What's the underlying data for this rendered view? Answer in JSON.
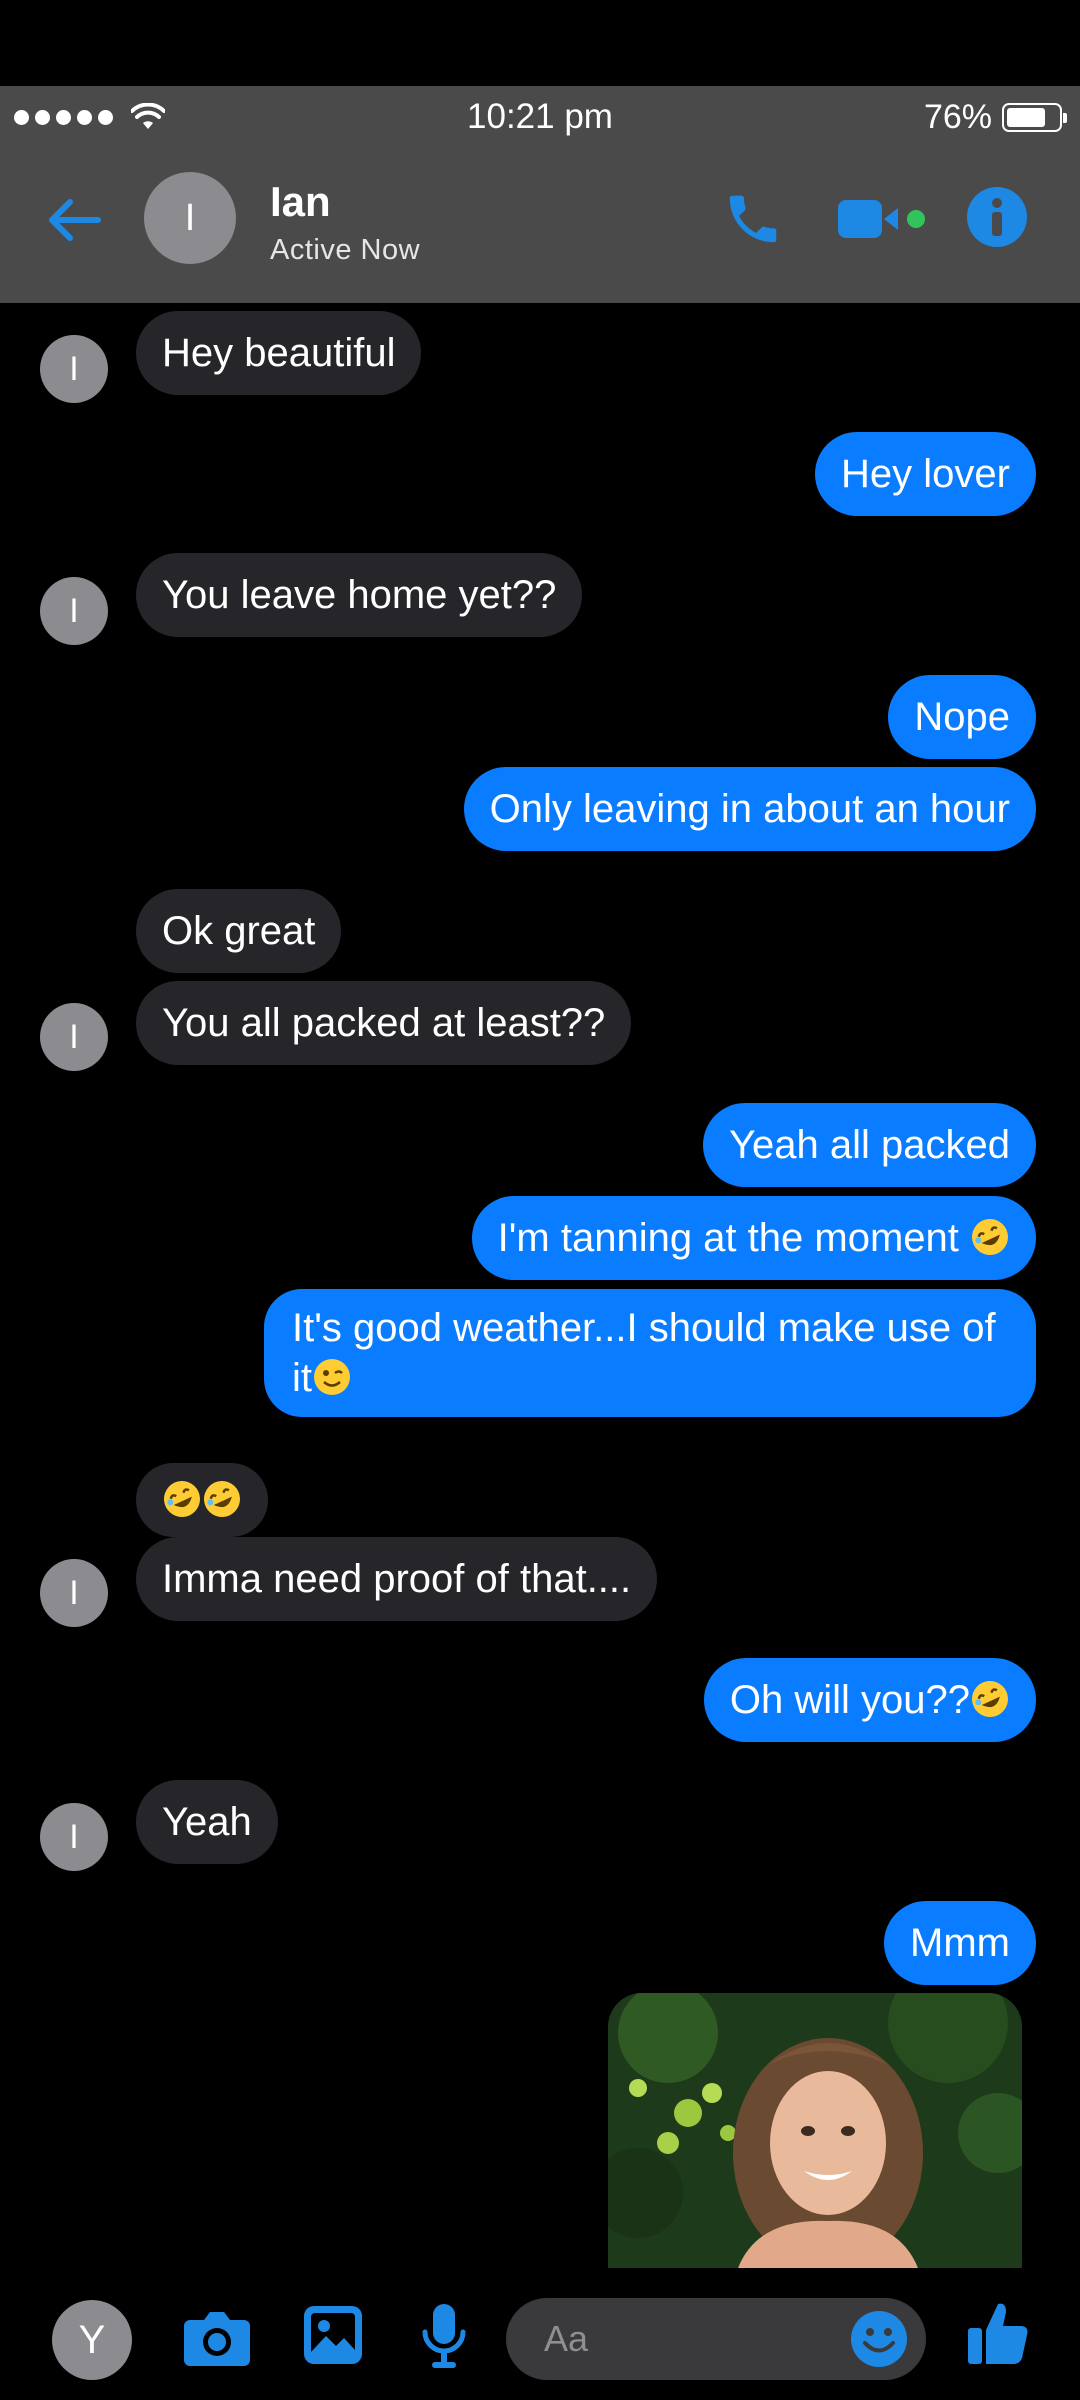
{
  "status_bar": {
    "time": "10:21 pm",
    "battery_percent": "76%",
    "signal_bars": 5,
    "battery_level": 0.76
  },
  "header": {
    "avatar_initial": "I",
    "name": "Ian",
    "status": "Active Now",
    "accent_color": "#1e88e5",
    "online_color": "#31c45a"
  },
  "messages": [
    {
      "side": "in",
      "text": "Hey beautiful",
      "avatar": "I"
    },
    {
      "side": "out",
      "text": "Hey lover"
    },
    {
      "side": "in",
      "text": "You leave home yet??",
      "avatar": "I"
    },
    {
      "side": "out",
      "text": "Nope"
    },
    {
      "side": "out",
      "text": "Only leaving in about an hour"
    },
    {
      "side": "in",
      "text": "Ok great"
    },
    {
      "side": "in",
      "text": "You all packed at least??",
      "avatar": "I"
    },
    {
      "side": "out",
      "text": "Yeah all packed"
    },
    {
      "side": "out",
      "text": "I'm tanning at the moment",
      "emoji": "rofl-emoji"
    },
    {
      "side": "out",
      "text_line1": "It's good weather...I should make use of",
      "text_line2": "it",
      "emoji": "wink-emoji"
    },
    {
      "side": "in",
      "text": "",
      "emoji": "rofl-emoji-x2"
    },
    {
      "side": "in",
      "text": "Imma need proof of that....",
      "avatar": "I"
    },
    {
      "side": "out",
      "text": "Oh will you??",
      "emoji": "rofl-emoji"
    },
    {
      "side": "in",
      "text": "Yeah",
      "avatar": "I"
    },
    {
      "side": "out",
      "text": "Mmm"
    },
    {
      "side": "out",
      "type": "photo"
    }
  ],
  "composer": {
    "avatar_initial": "Y",
    "placeholder": "Aa"
  },
  "colors": {
    "outgoing_bubble": "#0a7cff",
    "incoming_bubble": "#26252a",
    "bar_background": "#4a4a4a",
    "background": "#000000"
  }
}
